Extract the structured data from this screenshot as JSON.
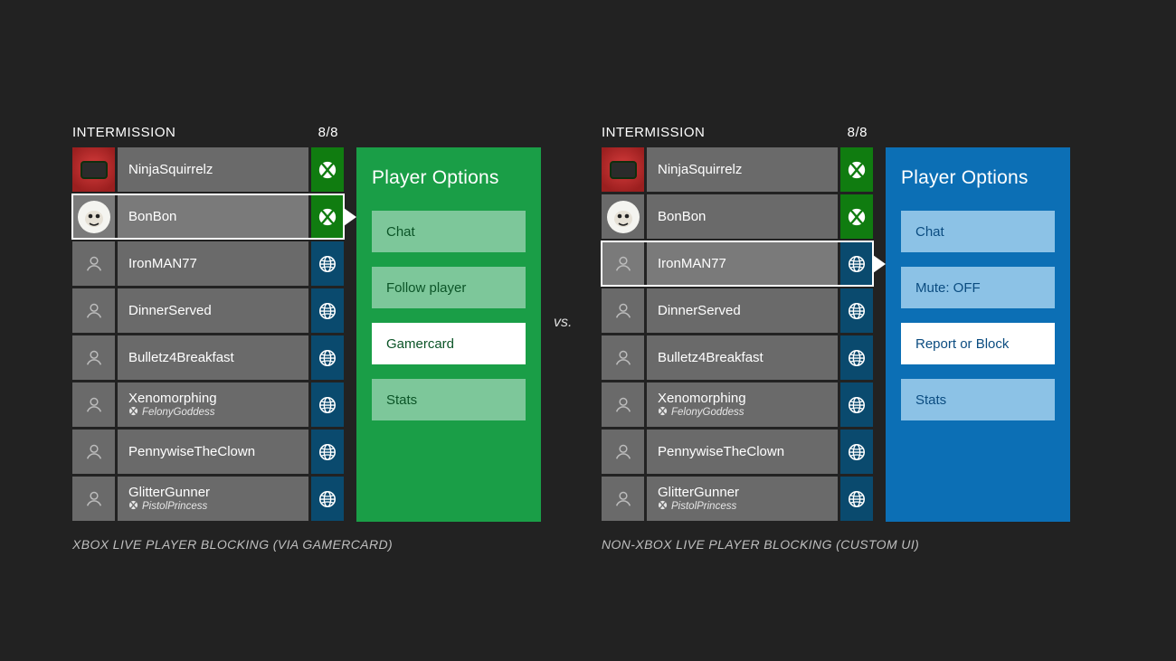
{
  "vs_label": "vs.",
  "panels": {
    "left": {
      "header_label": "INTERMISSION",
      "count": "8/8",
      "caption": "XBOX LIVE PLAYER BLOCKING (VIA GAMERCARD)",
      "flyout": {
        "title": "Player Options",
        "options": [
          {
            "label": "Chat",
            "active": false
          },
          {
            "label": "Follow player",
            "active": false
          },
          {
            "label": "Gamercard",
            "active": true
          },
          {
            "label": "Stats",
            "active": false
          }
        ]
      },
      "players": [
        {
          "name": "NinjaSquirrelz",
          "network": "xbox",
          "avatar": "red-console",
          "selected": false
        },
        {
          "name": "BonBon",
          "network": "xbox",
          "avatar": "yeti",
          "selected": true
        },
        {
          "name": "IronMAN77",
          "network": "globe",
          "avatar": "person",
          "selected": false
        },
        {
          "name": "DinnerServed",
          "network": "globe",
          "avatar": "person",
          "selected": false
        },
        {
          "name": "Bulletz4Breakfast",
          "network": "globe",
          "avatar": "person",
          "selected": false
        },
        {
          "name": "Xenomorphing",
          "network": "globe",
          "avatar": "person",
          "selected": false,
          "sub": "FelonyGoddess",
          "sub_icon": "xbox"
        },
        {
          "name": "PennywiseTheClown",
          "network": "globe",
          "avatar": "person",
          "selected": false
        },
        {
          "name": "GlitterGunner",
          "network": "globe",
          "avatar": "person",
          "selected": false,
          "sub": "PistolPrincess",
          "sub_icon": "xbox"
        }
      ]
    },
    "right": {
      "header_label": "INTERMISSION",
      "count": "8/8",
      "caption": "NON-XBOX LIVE PLAYER BLOCKING (CUSTOM UI)",
      "flyout": {
        "title": "Player Options",
        "options": [
          {
            "label": "Chat",
            "active": false
          },
          {
            "label": "Mute: OFF",
            "active": false
          },
          {
            "label": "Report or Block",
            "active": true
          },
          {
            "label": "Stats",
            "active": false
          }
        ]
      },
      "players": [
        {
          "name": "NinjaSquirrelz",
          "network": "xbox",
          "avatar": "red-console",
          "selected": false
        },
        {
          "name": "BonBon",
          "network": "xbox",
          "avatar": "yeti",
          "selected": false
        },
        {
          "name": "IronMAN77",
          "network": "globe",
          "avatar": "person",
          "selected": true
        },
        {
          "name": "DinnerServed",
          "network": "globe",
          "avatar": "person",
          "selected": false
        },
        {
          "name": "Bulletz4Breakfast",
          "network": "globe",
          "avatar": "person",
          "selected": false
        },
        {
          "name": "Xenomorphing",
          "network": "globe",
          "avatar": "person",
          "selected": false,
          "sub": "FelonyGoddess",
          "sub_icon": "xbox"
        },
        {
          "name": "PennywiseTheClown",
          "network": "globe",
          "avatar": "person",
          "selected": false
        },
        {
          "name": "GlitterGunner",
          "network": "globe",
          "avatar": "person",
          "selected": false,
          "sub": "PistolPrincess",
          "sub_icon": "xbox"
        }
      ]
    }
  }
}
